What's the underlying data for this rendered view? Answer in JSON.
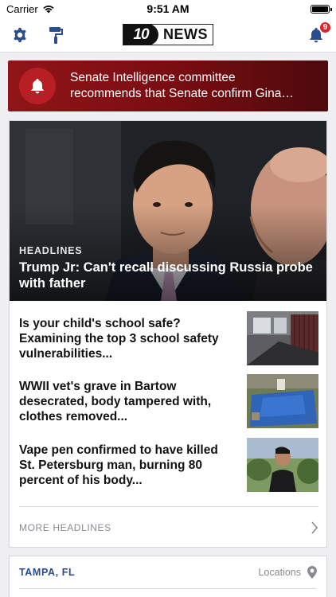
{
  "status_bar": {
    "carrier": "Carrier",
    "time": "9:51 AM"
  },
  "nav": {
    "logo_number": "10",
    "logo_text": "NEWS",
    "notification_count": "9",
    "icons": [
      "gear-icon",
      "paint-roller-icon",
      "bell-icon"
    ]
  },
  "alert": {
    "text": "Senate Intelligence committee recommends that Senate confirm Gina Haspel",
    "icon": "bell-icon",
    "colors": {
      "bg": "#7a0d12",
      "circle": "#b81f25"
    }
  },
  "headlines": {
    "hero": {
      "section": "HEADLINES",
      "title": "Trump Jr: Can't recall discussing Russia probe with father"
    },
    "stories": [
      {
        "title": "Is your child's school safe? Examining the top 3 school safety vulnerabilities..."
      },
      {
        "title": "WWII vet's grave in Bartow desecrated, body tampered with, clothes removed..."
      },
      {
        "title": "Vape pen confirmed to have killed St. Petersburg man, burning 80 percent of his body..."
      }
    ],
    "more_label": "MORE HEADLINES"
  },
  "location": {
    "city": "TAMPA, FL",
    "link_label": "Locations",
    "accent": "#2a4d8f"
  }
}
